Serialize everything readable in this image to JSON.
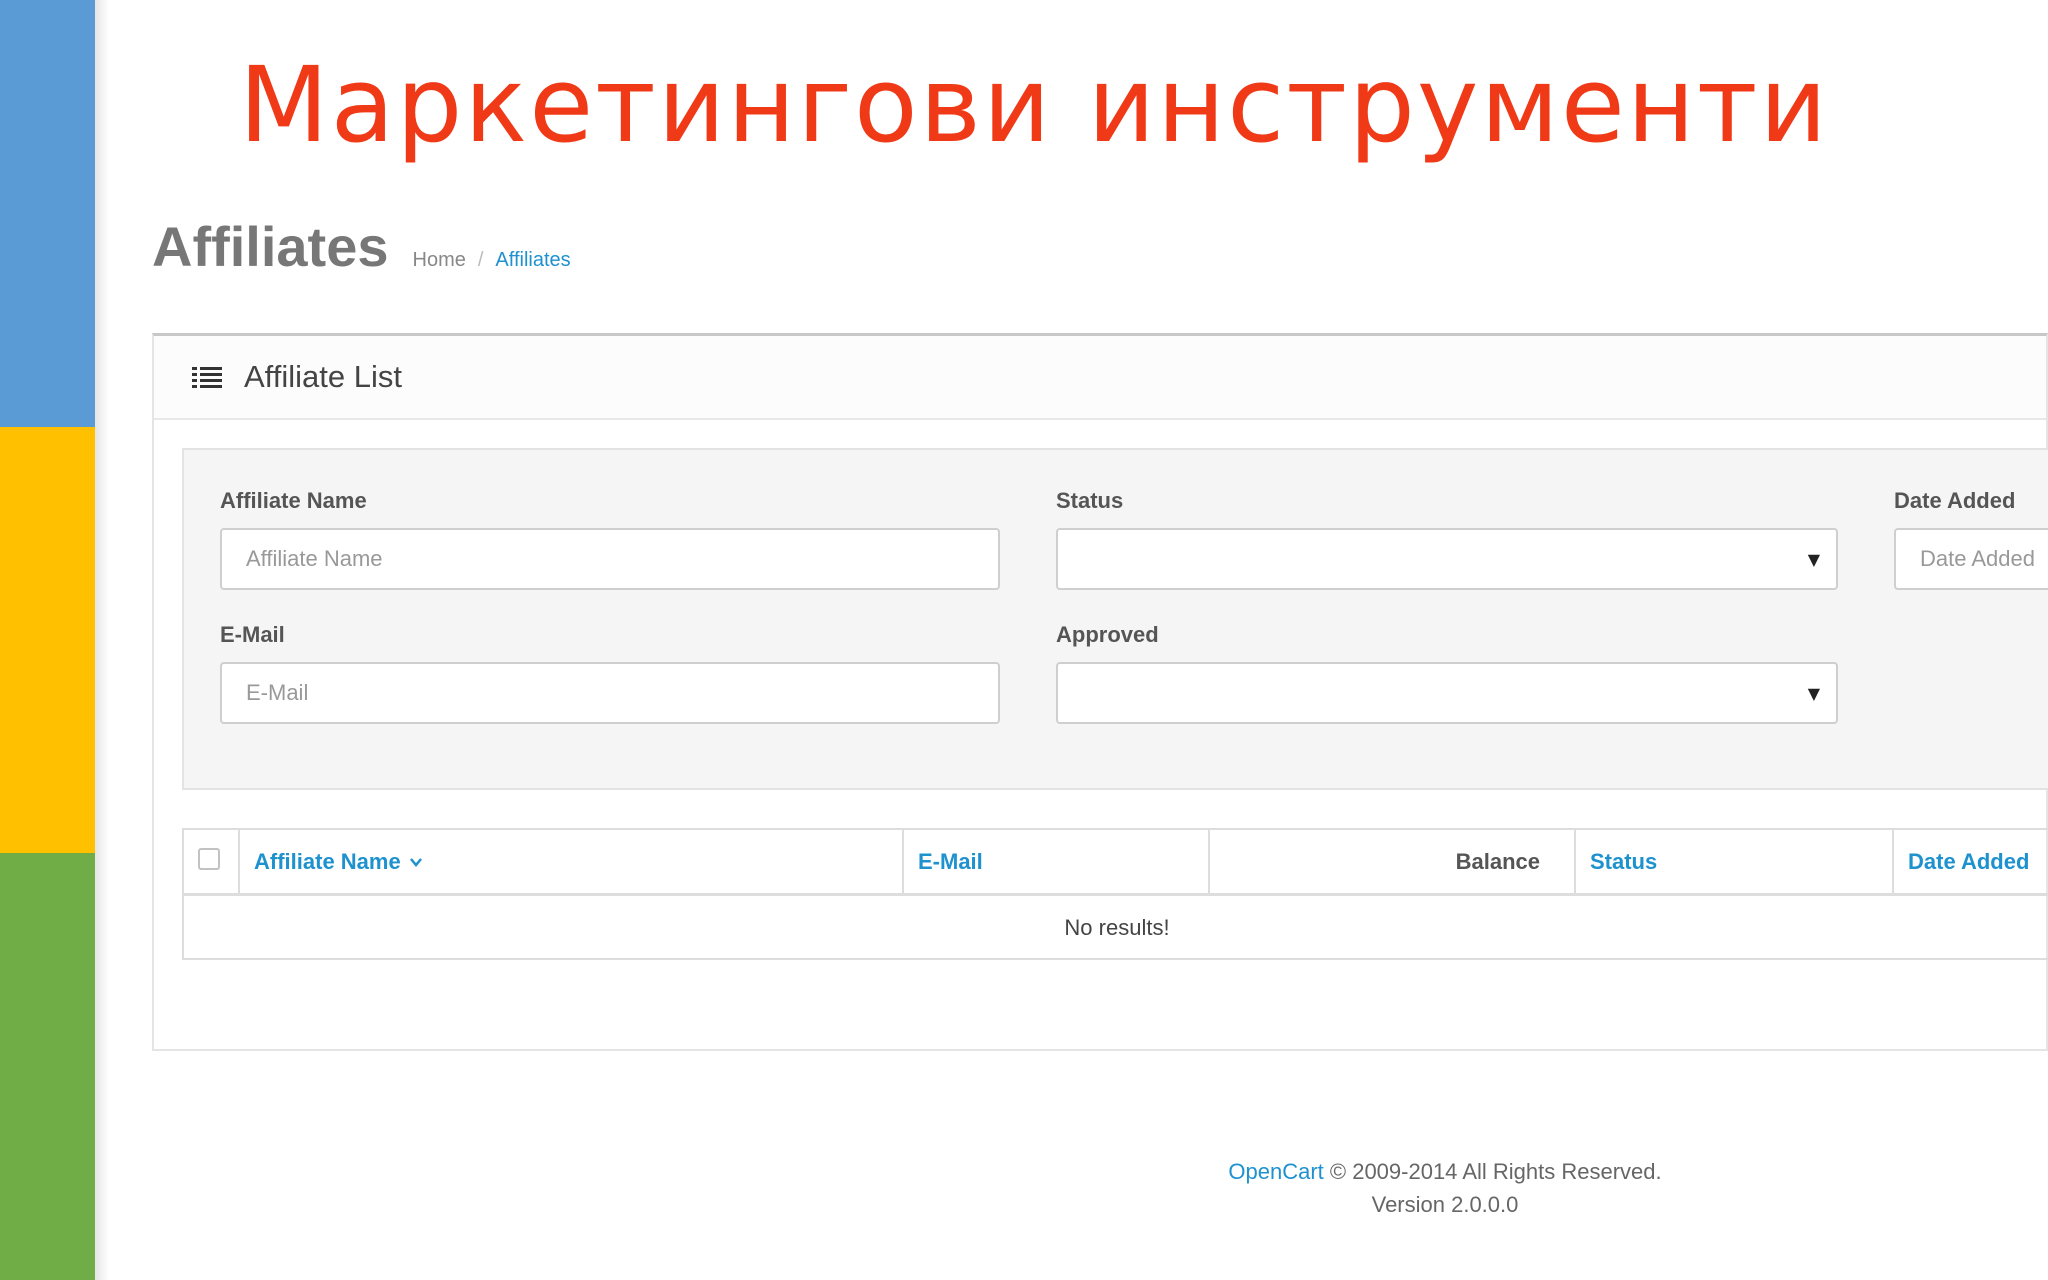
{
  "slide": {
    "title": "Маркетингови инструменти",
    "strip_colors": [
      "#5b9bd5",
      "#ffc000",
      "#70ad47"
    ]
  },
  "header": {
    "title": "Affiliates",
    "breadcrumb": {
      "home": "Home",
      "separator": "/",
      "current": "Affiliates"
    }
  },
  "panel": {
    "title": "Affiliate List",
    "icon": "list-icon"
  },
  "filters": {
    "affiliate_name": {
      "label": "Affiliate Name",
      "placeholder": "Affiliate Name",
      "value": ""
    },
    "email": {
      "label": "E-Mail",
      "placeholder": "E-Mail",
      "value": ""
    },
    "status": {
      "label": "Status",
      "value": ""
    },
    "approved": {
      "label": "Approved",
      "value": ""
    },
    "date_added": {
      "label": "Date Added",
      "placeholder": "Date Added",
      "value": ""
    }
  },
  "table": {
    "columns": {
      "affiliate_name": "Affiliate Name",
      "email": "E-Mail",
      "balance": "Balance",
      "status": "Status",
      "date_added": "Date Added"
    },
    "sorted_column": "affiliate_name",
    "empty_message": "No results!"
  },
  "footer": {
    "brand": "OpenCart",
    "copyright": "© 2009-2014 All Rights Reserved.",
    "version": "Version 2.0.0.0"
  },
  "colors": {
    "title_red": "#f03a17",
    "link_blue": "#1e91cf"
  }
}
